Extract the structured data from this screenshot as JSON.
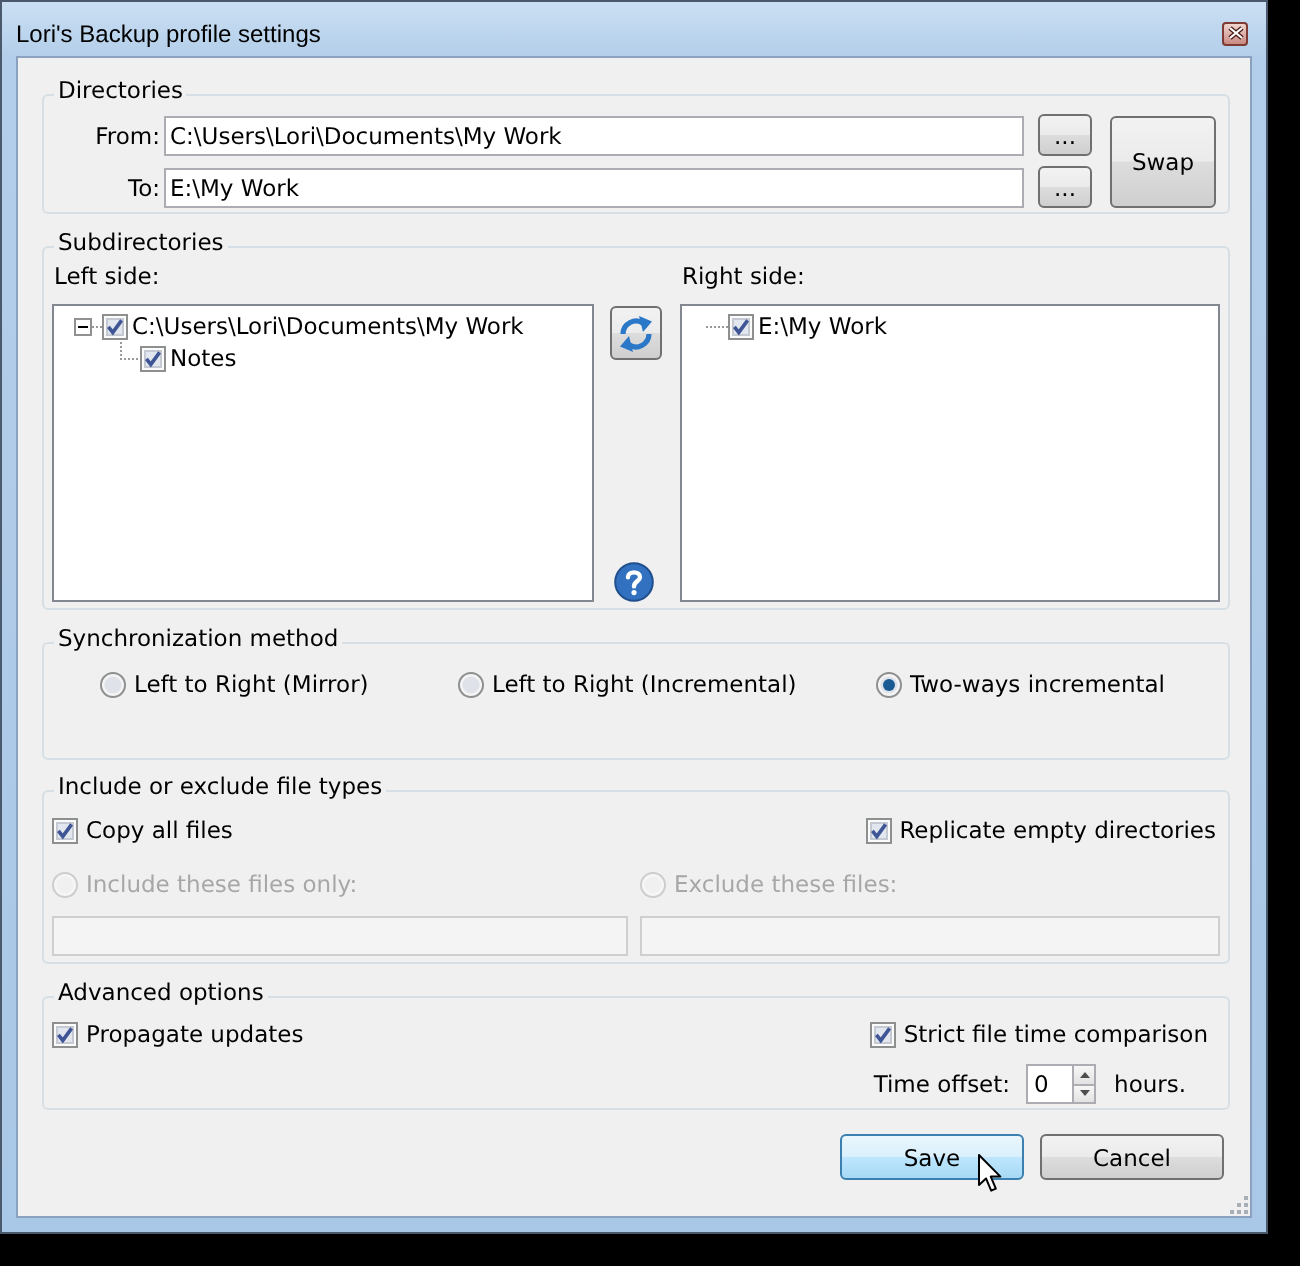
{
  "window": {
    "title": "Lori's Backup profile settings"
  },
  "directories": {
    "legend": "Directories",
    "rows": [
      {
        "label": "From:",
        "value": "C:\\Users\\Lori\\Documents\\My Work",
        "browse": "..."
      },
      {
        "label": "To:",
        "value": "E:\\My Work",
        "browse": "..."
      }
    ],
    "swap": "Swap"
  },
  "subdirectories": {
    "legend": "Subdirectories",
    "panes": [
      {
        "label": "Left side:",
        "tree": [
          {
            "label": "C:\\Users\\Lori\\Documents\\My Work",
            "checked": true,
            "expanded": true,
            "children": [
              {
                "label": "Notes",
                "checked": true
              }
            ]
          }
        ]
      },
      {
        "label": "Right side:",
        "tree": [
          {
            "label": "E:\\My Work",
            "checked": true
          }
        ]
      }
    ]
  },
  "sync_method": {
    "legend": "Synchronization method",
    "options": [
      {
        "label": "Left to Right (Mirror)",
        "selected": false
      },
      {
        "label": "Left to Right (Incremental)",
        "selected": false
      },
      {
        "label": "Two-ways incremental",
        "selected": true
      }
    ]
  },
  "file_types": {
    "legend": "Include or exclude file types",
    "checkboxes": [
      {
        "label": "Copy all files",
        "checked": true
      },
      {
        "label": "Replicate empty directories",
        "checked": true
      }
    ],
    "filters": [
      {
        "label": "Include these files only:",
        "selected": false,
        "disabled": true
      },
      {
        "label": "Exclude these files:",
        "selected": false,
        "disabled": true
      }
    ]
  },
  "advanced": {
    "legend": "Advanced options",
    "checkboxes": [
      {
        "label": "Propagate updates",
        "checked": true
      },
      {
        "label": "Strict file time comparison",
        "checked": true
      }
    ],
    "time_offset": {
      "label": "Time offset:",
      "value": "0",
      "unit": "hours."
    }
  },
  "buttons": [
    {
      "label": "Save",
      "hovered": true
    },
    {
      "label": "Cancel",
      "hovered": false
    }
  ]
}
